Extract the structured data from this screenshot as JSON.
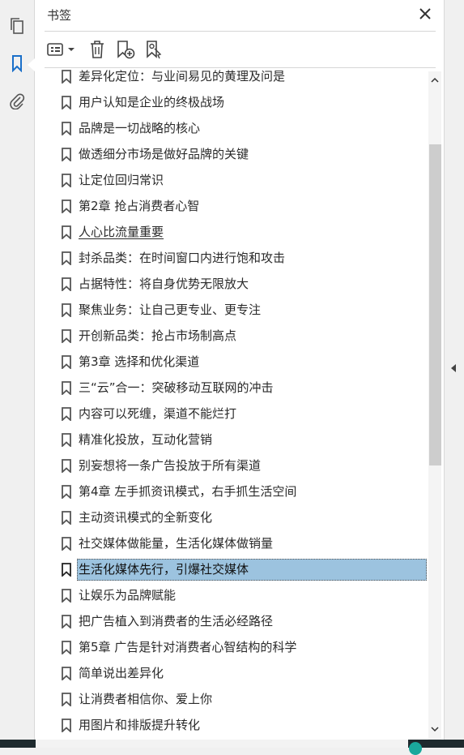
{
  "panel": {
    "title": "书签"
  },
  "rail": {
    "icons": [
      "pages-icon",
      "bookmarks-icon",
      "attachments-icon"
    ]
  },
  "toolbar": {
    "options_icon": "list-options-icon",
    "delete_icon": "trash-icon",
    "new_icon": "new-bookmark-icon",
    "new_from_structure_icon": "bookmark-from-structure-icon"
  },
  "colors": {
    "selection": "#9cc3df",
    "panel_bg": "#ffffff",
    "chrome_bg": "#f0f0f0"
  },
  "bookmarks": [
    "差异化定位：与业间易见的黄理及问是",
    "用户认知是企业的终极战场",
    "品牌是一切战略的核心",
    "做透细分市场是做好品牌的关键",
    "让定位回归常识",
    "第2章 抢占消费者心智",
    "人心比流量重要",
    "封杀品类：在时间窗口内进行饱和攻击",
    "占据特性：将自身优势无限放大",
    "聚焦业务：让自己更专业、更专注",
    "开创新品类：抢占市场制高点",
    "第3章 选择和优化渠道",
    "三“云”合一：突破移动互联网的冲击",
    "内容可以死缠，渠道不能烂打",
    "精准化投放，互动化营销",
    "别妄想将一条广告投放于所有渠道",
    "第4章 左手抓资讯模式，右手抓生活空间",
    "主动资讯模式的全新变化",
    "社交媒体做能量，生活化媒体做销量",
    "生活化媒体先行，引爆社交媒体",
    "让娱乐为品牌赋能",
    "把广告植入到消费者的生活必经路径",
    "第5章 广告是针对消费者心智结构的科学",
    "简单说出差异化",
    "让消费者相信你、爱上你",
    "用图片和排版提升转化"
  ],
  "selected_index": 19,
  "underlined_index": 6
}
